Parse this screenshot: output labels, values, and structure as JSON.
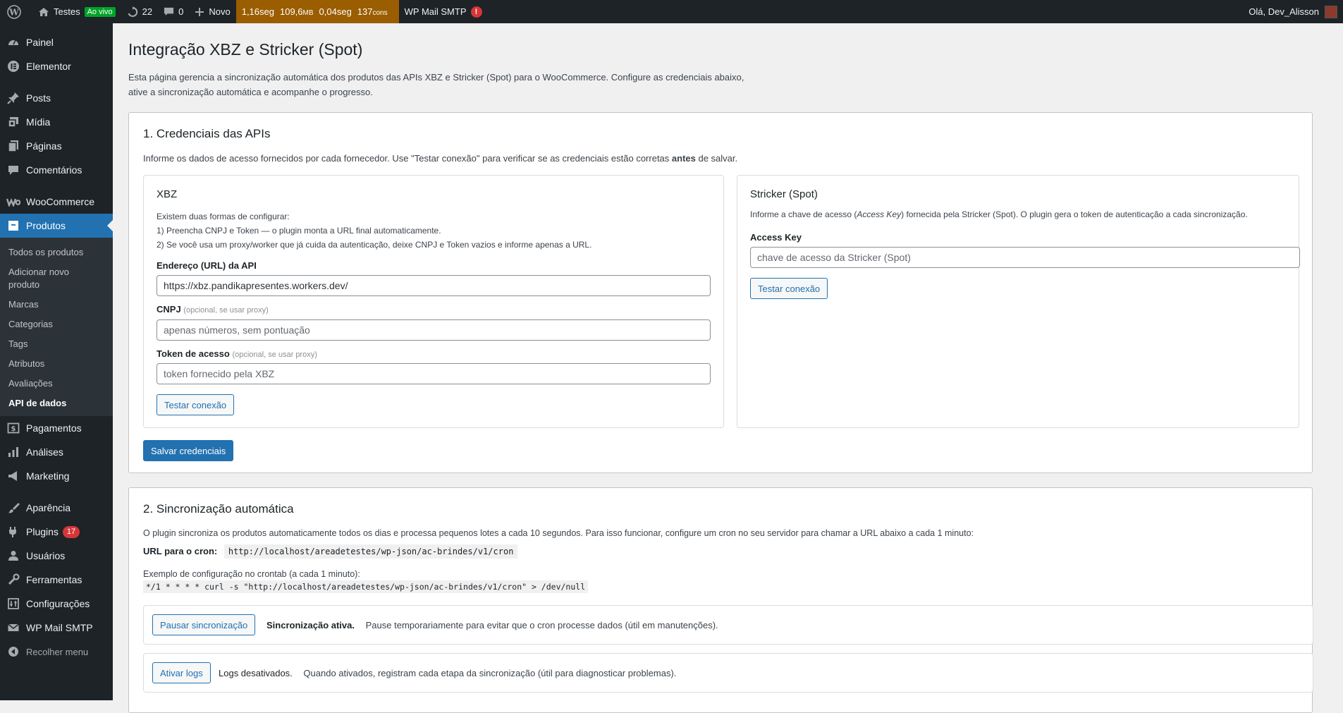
{
  "adminbar": {
    "site_name": "Testes",
    "live_badge": "Ao vivo",
    "updates_count": "22",
    "comments_count": "0",
    "new_label": "Novo",
    "perf_time": "1,16seg",
    "perf_mem": "109,6",
    "perf_mem_unit": "MB",
    "perf_query_time": "0,04seg",
    "perf_queries": "137",
    "perf_queries_unit": "cons",
    "smtp_label": "WP Mail SMTP",
    "smtp_alert": "!",
    "greeting": "Olá, Dev_Alisson"
  },
  "sidebar": {
    "items": [
      {
        "label": "Painel",
        "icon": "dashboard-icon"
      },
      {
        "label": "Elementor",
        "icon": "elementor-icon"
      },
      {
        "label": "Posts",
        "icon": "pin-icon"
      },
      {
        "label": "Mídia",
        "icon": "media-icon"
      },
      {
        "label": "Páginas",
        "icon": "pages-icon"
      },
      {
        "label": "Comentários",
        "icon": "comments-icon"
      },
      {
        "label": "WooCommerce",
        "icon": "woocommerce-icon"
      },
      {
        "label": "Produtos",
        "icon": "products-icon"
      },
      {
        "label": "Pagamentos",
        "icon": "payments-icon"
      },
      {
        "label": "Análises",
        "icon": "analytics-icon"
      },
      {
        "label": "Marketing",
        "icon": "marketing-icon"
      },
      {
        "label": "Aparência",
        "icon": "appearance-icon"
      },
      {
        "label": "Plugins",
        "icon": "plugins-icon",
        "badge": "17"
      },
      {
        "label": "Usuários",
        "icon": "users-icon"
      },
      {
        "label": "Ferramentas",
        "icon": "tools-icon"
      },
      {
        "label": "Configurações",
        "icon": "settings-icon"
      },
      {
        "label": "WP Mail SMTP",
        "icon": "mail-icon"
      },
      {
        "label": "Recolher menu",
        "icon": "collapse-icon"
      }
    ],
    "submenu": [
      "Todos os produtos",
      "Adicionar novo produto",
      "Marcas",
      "Categorias",
      "Tags",
      "Atributos",
      "Avaliações",
      "API de dados"
    ]
  },
  "main": {
    "title": "Integração XBZ e Stricker (Spot)",
    "intro": "Esta página gerencia a sincronização automática dos produtos das APIs XBZ e Stricker (Spot) para o WooCommerce. Configure as credenciais abaixo, ative a sincronização automática e acompanhe o progresso.",
    "credentials": {
      "heading": "1. Credenciais das APIs",
      "desc_prefix": "Informe os dados de acesso fornecidos por cada fornecedor. Use \"Testar conexão\" para verificar se as credenciais estão corretas ",
      "desc_bold": "antes",
      "desc_suffix": " de salvar.",
      "xbz": {
        "title": "XBZ",
        "help_1": "Existem duas formas de configurar:",
        "help_2": "1) Preencha CNPJ e Token — o plugin monta a URL final automaticamente.",
        "help_3": "2) Se você usa um proxy/worker que já cuida da autenticação, deixe CNPJ e Token vazios e informe apenas a URL.",
        "url_label": "Endereço (URL) da API",
        "url_value": "https://xbz.pandikapresentes.workers.dev/",
        "cnpj_label": "CNPJ",
        "cnpj_hint": "(opcional, se usar proxy)",
        "cnpj_placeholder": "apenas números, sem pontuação",
        "token_label": "Token de acesso",
        "token_hint": "(opcional, se usar proxy)",
        "token_placeholder": "token fornecido pela XBZ",
        "test_button": "Testar conexão"
      },
      "stricker": {
        "title": "Stricker (Spot)",
        "desc_prefix": "Informe a chave de acesso (",
        "desc_italic": "Access Key",
        "desc_suffix": ") fornecida pela Stricker (Spot). O plugin gera o token de autenticação a cada sincronização.",
        "key_label": "Access Key",
        "key_placeholder": "chave de acesso da Stricker (Spot)",
        "test_button": "Testar conexão"
      },
      "save_button": "Salvar credenciais"
    },
    "sync": {
      "heading": "2. Sincronização automática",
      "desc": "O plugin sincroniza os produtos automaticamente todos os dias e processa pequenos lotes a cada 10 segundos. Para isso funcionar, configure um cron no seu servidor para chamar a URL abaixo a cada 1 minuto:",
      "cron_label": "URL para o cron:",
      "cron_url": "http://localhost/areadetestes/wp-json/ac-brindes/v1/cron",
      "crontab_label": "Exemplo de configuração no crontab (a cada 1 minuto):",
      "crontab_example": "*/1 * * * * curl -s \"http://localhost/areadetestes/wp-json/ac-brindes/v1/cron\" > /dev/null",
      "pause_button": "Pausar sincronização",
      "sync_status": "Sincronização ativa.",
      "sync_note": "Pause temporariamente para evitar que o cron processe dados (útil em manutenções).",
      "logs_button": "Ativar logs",
      "logs_status": "Logs desativados.",
      "logs_note": "Quando ativados, registram cada etapa da sincronização (útil para diagnosticar problemas)."
    }
  },
  "colors": {
    "accent": "#2271b1",
    "sidebar": "#1d2327",
    "perf": "#9a5d00",
    "alert": "#d63638",
    "live": "#00a32a"
  }
}
